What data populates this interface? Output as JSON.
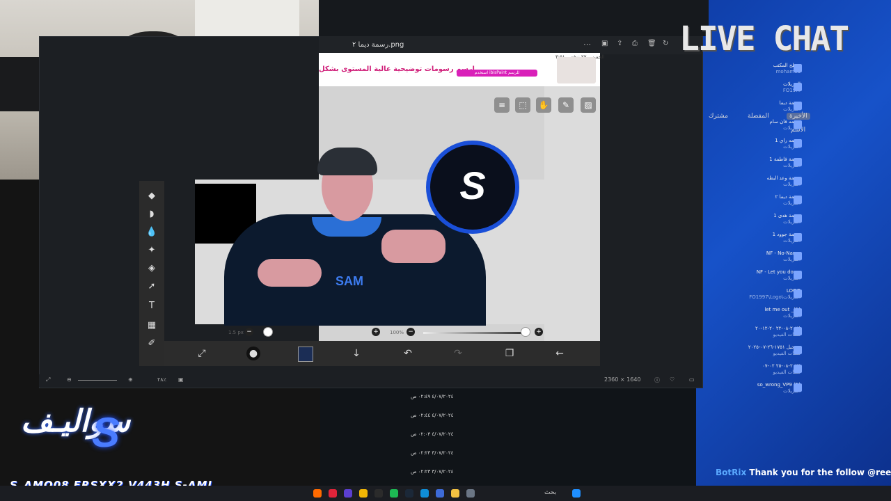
{
  "window": {
    "title": "رسمة ديما ٢.png",
    "status_dims": "2360 × 1640",
    "status_zoom": "٢٨٪"
  },
  "ad": {
    "text": "ارسم رسومات توضيحية عالية المستوى بشكل",
    "top_line": "الخميس ٢٧ نوفمبر ٣:٥١",
    "badge": "استخدم ibisPaint للرسم"
  },
  "canvas": {
    "art_text": "SAM",
    "logo_letter": "S"
  },
  "sliders": {
    "size_label": "1.5 px",
    "opacity_label": "100%"
  },
  "overlay": {
    "live_chat": "LIVE CHAT",
    "brand_name": "سواليـف",
    "socials": "S_AMO08  FRSXX2  V443H  S-AMI",
    "botrix_name": "BotRix",
    "botrix_msg": "Thank you for the follow @reet"
  },
  "explorer": {
    "nav_shared": "مشترك",
    "nav_fav": "المفضلة",
    "nav_recent": "الأخيرة",
    "col_name": "الاسم",
    "items": [
      {
        "name": "سطح المكتب",
        "sub": "mohamed"
      },
      {
        "name": "التنزيلات",
        "sub": "FO19..."
      },
      {
        "name": "رسمة ديما",
        "sub": "التنزيلات"
      },
      {
        "name": "رسمه فان سام",
        "sub": "التنزيلات"
      },
      {
        "name": "رسمه راي 1",
        "sub": "التنزيلات"
      },
      {
        "name": "رسمة فاطمة 1",
        "sub": "التنزيلات"
      },
      {
        "name": "رسمة وعد البطه",
        "sub": "التنزيلات"
      },
      {
        "name": "رسمة ديما ٢",
        "sub": "التنزيلات"
      },
      {
        "name": "رسمة هدى 1",
        "sub": "التنزيلات"
      },
      {
        "name": "رسمة جوود 1",
        "sub": "التنزيلات"
      },
      {
        "name": "NF - No-Name",
        "sub": "التنزيلات"
      },
      {
        "name": "NF - Let you down",
        "sub": "التنزيلات"
      },
      {
        "name": "LOGO",
        "sub": "FO1997\\Logo\\التنزيلات"
      },
      {
        "name": "let me out _(1)",
        "sub": "التنزيلات"
      },
      {
        "name": "٢٠٢٤-٠٨-٢٢ ٢٠-١٢-٢٠",
        "sub": "ملفات الفيديو"
      },
      {
        "name": "تسجيل ١٧٥١-٢٦-٠٧-٢٠٢٥",
        "sub": "ملفات الفيديو"
      },
      {
        "name": "٢٠٢٥-٠٨-٢٥ ٠٢-٠٧",
        "sub": "ملفات الفيديو"
      },
      {
        "name": "so_wrong_VP9 (1)",
        "sub": "التنزيلات"
      }
    ]
  },
  "dates": [
    "٤/٠٧/٢٠٢٤ ٠٢:٤٩ ص",
    "٤/٠٧/٢٠٢٤ ٠٢:٤٤ ص",
    "٤/٠٧/٢٠٢٤ ٠٢:٠٣ ص",
    "٣/٠٧/٢٠٢٤ ٠٢:٢٣ ص",
    "٣/٠٧/٢٠٢٤ ٠٢:٢٣ ص"
  ],
  "taskbar": {
    "search": "بحث"
  },
  "colors": {
    "accent_blue": "#1a4fd8",
    "botrix": "#5aa9ff"
  }
}
